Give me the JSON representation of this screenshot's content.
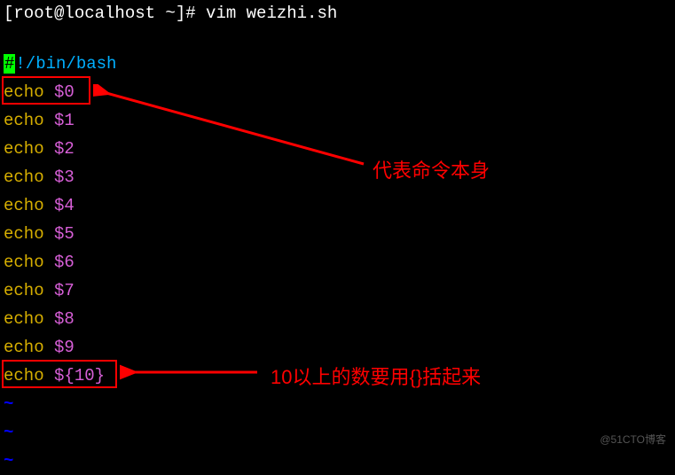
{
  "prompt": "[root@localhost ~]# vim weizhi.sh",
  "shebang_first": "#",
  "shebang_rest": "!/bin/bash",
  "lines": [
    {
      "cmd": "echo",
      "var": "$0"
    },
    {
      "cmd": "echo",
      "var": "$1"
    },
    {
      "cmd": "echo",
      "var": "$2"
    },
    {
      "cmd": "echo",
      "var": "$3"
    },
    {
      "cmd": "echo",
      "var": "$4"
    },
    {
      "cmd": "echo",
      "var": "$5"
    },
    {
      "cmd": "echo",
      "var": "$6"
    },
    {
      "cmd": "echo",
      "var": "$7"
    },
    {
      "cmd": "echo",
      "var": "$8"
    },
    {
      "cmd": "echo",
      "var": "$9"
    },
    {
      "cmd": "echo",
      "var": "${10}"
    }
  ],
  "tilde": "~",
  "annotation1": "代表命令本身",
  "annotation2": "10以上的数要用{}括起来",
  "watermark": "@51CTO博客"
}
